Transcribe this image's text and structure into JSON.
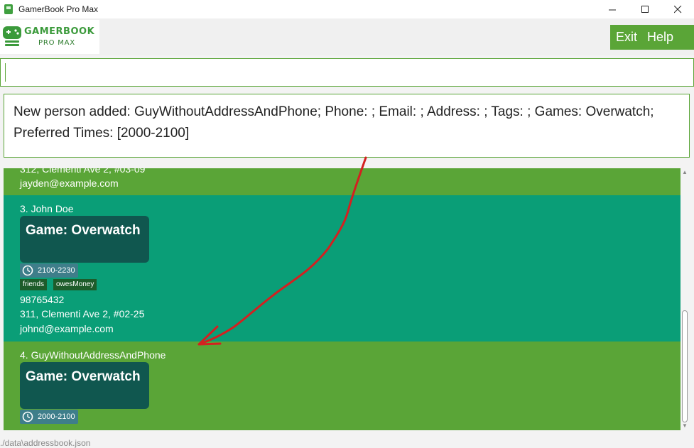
{
  "window": {
    "title": "GamerBook Pro Max"
  },
  "logo": {
    "line1": "GAMERBOOK",
    "line2": "PRO MAX"
  },
  "menu": {
    "exit_label": "Exit",
    "help_label": "Help"
  },
  "command": {
    "value": "",
    "placeholder": ""
  },
  "result": {
    "text": "New person added: GuyWithoutAddressAndPhone; Phone: ; Email: ; Address: ; Tags: ; Games: Overwatch; Preferred Times: [2000-2100]"
  },
  "persons": [
    {
      "address": "312, Clementi Ave 2, #03-09",
      "email": "jayden@example.com"
    },
    {
      "name": "3. John Doe",
      "game": "Game: Overwatch",
      "time": "2100-2230",
      "tags": [
        "friends",
        "owesMoney"
      ],
      "phone": "98765432",
      "address": "311, Clementi Ave 2, #02-25",
      "email": "johnd@example.com"
    },
    {
      "name": "4. GuyWithoutAddressAndPhone",
      "game": "Game: Overwatch",
      "time": "2000-2100"
    }
  ],
  "status": {
    "path": "./data\\addressbook.json"
  },
  "colors": {
    "accent_green": "#5aa537",
    "teal_card": "#0a9e77",
    "game_box": "#10574f",
    "annotation_red": "#d42020"
  },
  "icons": {
    "app": "gamepad-icon",
    "clock": "clock-icon"
  }
}
